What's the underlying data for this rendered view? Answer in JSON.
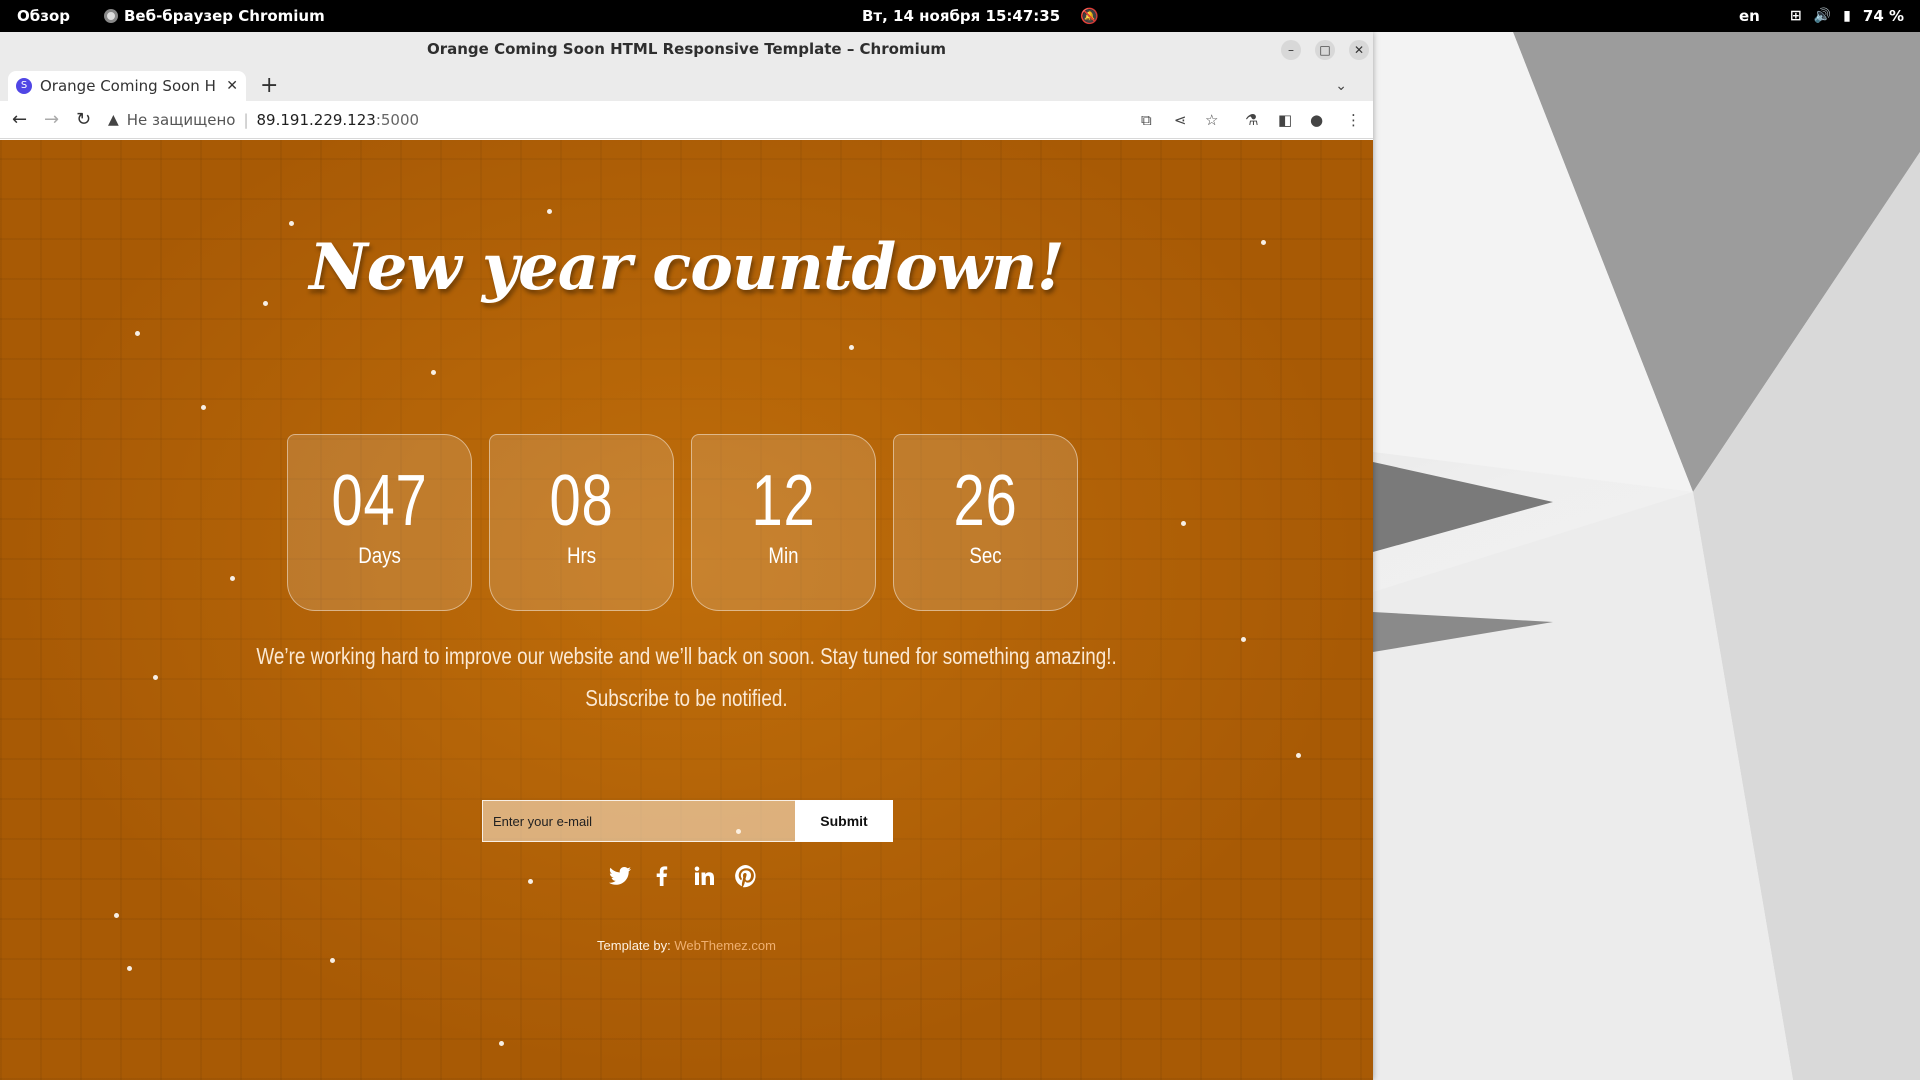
{
  "topbar": {
    "activities": "Обзор",
    "app_name": "Веб-браузер Chromium",
    "datetime": "Вт, 14 ноября  15:47:35",
    "lang": "en",
    "battery": "74 %"
  },
  "window": {
    "title": "Orange Coming Soon HTML Responsive Template – Chromium"
  },
  "tabs": [
    {
      "title": "Orange Coming Soon H",
      "favicon": "S"
    }
  ],
  "address_bar": {
    "security_label": "Не защищено",
    "host": "89.191.229.123",
    "port": ":5000"
  },
  "page": {
    "headline": "New year countdown!",
    "countdown": [
      {
        "value": "047",
        "unit": "Days"
      },
      {
        "value": "08",
        "unit": "Hrs"
      },
      {
        "value": "12",
        "unit": "Min"
      },
      {
        "value": "26",
        "unit": "Sec"
      }
    ],
    "message_line1": "We’re working hard to improve our website and we’ll back on soon. Stay tuned for something amazing!.",
    "message_line2": "Subscribe to be notified.",
    "email_placeholder": "Enter your e-mail",
    "submit_label": "Submit",
    "social": [
      "twitter",
      "facebook",
      "linkedin",
      "pinterest"
    ],
    "credit_prefix": "Template by:",
    "credit_link": "WebThemez.com"
  },
  "colors": {
    "page_bg": "#a85a05",
    "accent_link": "#f0b070"
  }
}
